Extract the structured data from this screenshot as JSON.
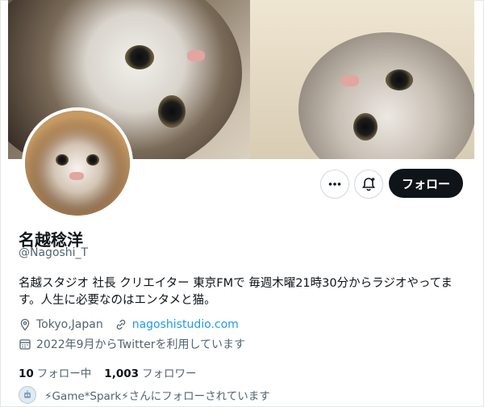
{
  "profile": {
    "display_name": "名越稔洋",
    "handle": "@Nagoshi_T",
    "bio": "名越スタジオ 社長 クリエイター 東京FMで 毎週木曜21時30分からラジオやってます。人生に必要なのはエンタメと猫。",
    "location": "Tokyo,Japan",
    "website": "nagoshistudio.com",
    "joined": "2022年9月からTwitterを利用しています"
  },
  "counts": {
    "following_count": "10",
    "following_label": "フォロー中",
    "followers_count": "1,003",
    "followers_label": "フォロワー"
  },
  "followed_by": {
    "text": "⚡Game*Spark⚡さんにフォローされています"
  },
  "actions": {
    "more_icon": "more-horizontal-icon",
    "notify_icon": "bell-plus-icon",
    "follow_label": "フォロー"
  },
  "colors": {
    "accent_link": "#1d9bf0",
    "follow_button_bg": "#0f1419",
    "secondary_text": "#536471"
  }
}
